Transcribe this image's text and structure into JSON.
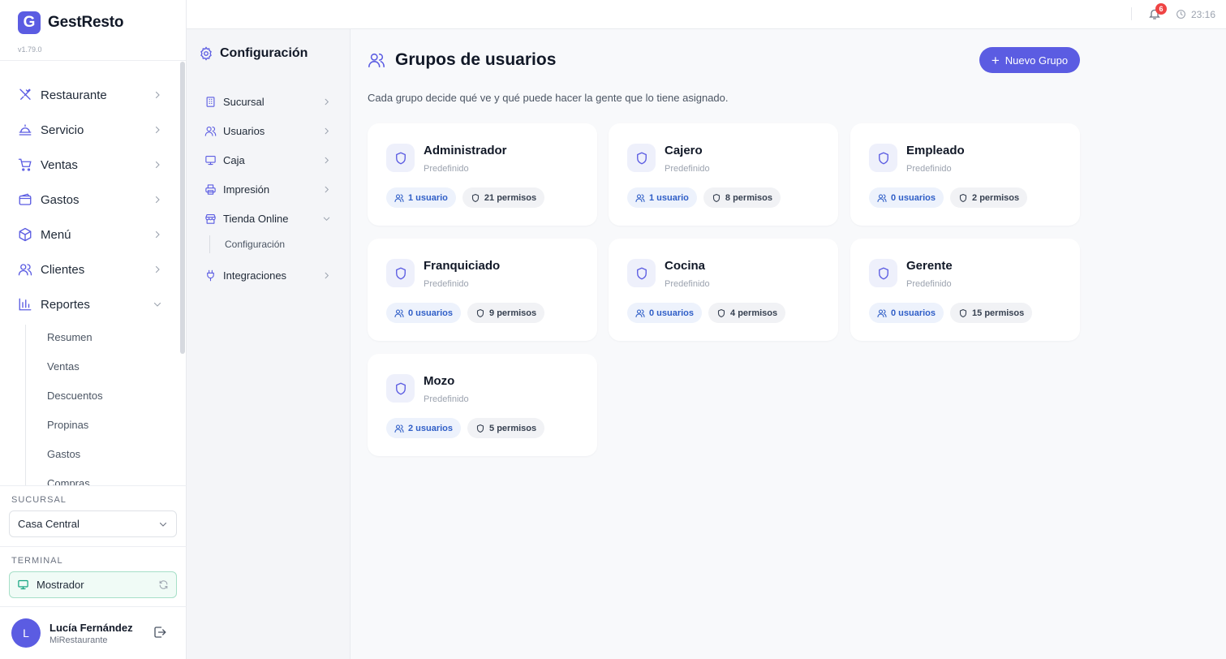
{
  "brand": {
    "logo_letter": "G",
    "name": "GestResto",
    "version": "v1.79.0"
  },
  "sidebar": {
    "items": [
      {
        "label": "Restaurante",
        "icon": "utensils-icon",
        "expanded": false
      },
      {
        "label": "Servicio",
        "icon": "cloche-icon",
        "expanded": false
      },
      {
        "label": "Ventas",
        "icon": "cart-icon",
        "expanded": false
      },
      {
        "label": "Gastos",
        "icon": "wallet-icon",
        "expanded": false
      },
      {
        "label": "Menú",
        "icon": "box-icon",
        "expanded": false
      },
      {
        "label": "Clientes",
        "icon": "users-icon",
        "expanded": false
      },
      {
        "label": "Reportes",
        "icon": "bar-chart-icon",
        "expanded": true
      }
    ],
    "report_subitems": [
      "Resumen",
      "Ventas",
      "Descuentos",
      "Propinas",
      "Gastos",
      "Compras"
    ],
    "branch": {
      "label": "SUCURSAL",
      "value": "Casa Central"
    },
    "terminal": {
      "label": "TERMINAL",
      "value": "Mostrador"
    },
    "user": {
      "initial": "L",
      "name": "Lucía Fernández",
      "org": "MiRestaurante"
    }
  },
  "topbar": {
    "notifications": "6",
    "time": "23:16"
  },
  "config_nav": {
    "title": "Configuración",
    "items": [
      {
        "label": "Sucursal",
        "icon": "building-icon"
      },
      {
        "label": "Usuarios",
        "icon": "users-icon"
      },
      {
        "label": "Caja",
        "icon": "monitor-icon"
      },
      {
        "label": "Impresión",
        "icon": "printer-icon"
      },
      {
        "label": "Tienda Online",
        "icon": "store-icon",
        "expanded": true
      },
      {
        "label": "Integraciones",
        "icon": "plug-icon"
      }
    ],
    "tienda_sub": "Configuración"
  },
  "main": {
    "title": "Grupos de usuarios",
    "description": "Cada grupo decide qué ve y qué puede hacer la gente que lo tiene asignado.",
    "new_button": "Nuevo Grupo",
    "groups": [
      {
        "name": "Administrador",
        "type": "Predefinido",
        "users": "1 usuario",
        "permissions": "21 permisos"
      },
      {
        "name": "Cajero",
        "type": "Predefinido",
        "users": "1 usuario",
        "permissions": "8 permisos"
      },
      {
        "name": "Empleado",
        "type": "Predefinido",
        "users": "0 usuarios",
        "permissions": "2 permisos"
      },
      {
        "name": "Franquiciado",
        "type": "Predefinido",
        "users": "0 usuarios",
        "permissions": "9 permisos"
      },
      {
        "name": "Cocina",
        "type": "Predefinido",
        "users": "0 usuarios",
        "permissions": "4 permisos"
      },
      {
        "name": "Gerente",
        "type": "Predefinido",
        "users": "0 usuarios",
        "permissions": "15 permisos"
      },
      {
        "name": "Mozo",
        "type": "Predefinido",
        "users": "2 usuarios",
        "permissions": "5 permisos"
      }
    ]
  },
  "colors": {
    "accent": "#5b5ce2",
    "user_pill_text": "#2f5ec7",
    "badge": "#ef4444",
    "terminal_border": "#a7dfc8"
  }
}
